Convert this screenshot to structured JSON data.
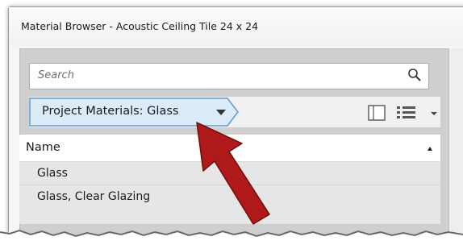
{
  "window": {
    "title": "Material Browser - Acoustic Ceiling Tile 24 x 24"
  },
  "search": {
    "placeholder": "Search"
  },
  "toolbar": {
    "project_materials_label": "Project Materials: Glass"
  },
  "list": {
    "column_header": "Name",
    "rows": [
      {
        "label": "Glass"
      },
      {
        "label": "Glass, Clear Glazing"
      }
    ]
  },
  "colors": {
    "accent_arrow": "#b01919",
    "dropdown_fill": "#dcebf8",
    "dropdown_border": "#5d9bd1"
  },
  "icons": {
    "search": "magnifier-icon",
    "view": "panel-view-icon",
    "list": "list-view-icon",
    "dropdown": "triangle-down-icon",
    "sort": "sort-ascending-icon"
  }
}
